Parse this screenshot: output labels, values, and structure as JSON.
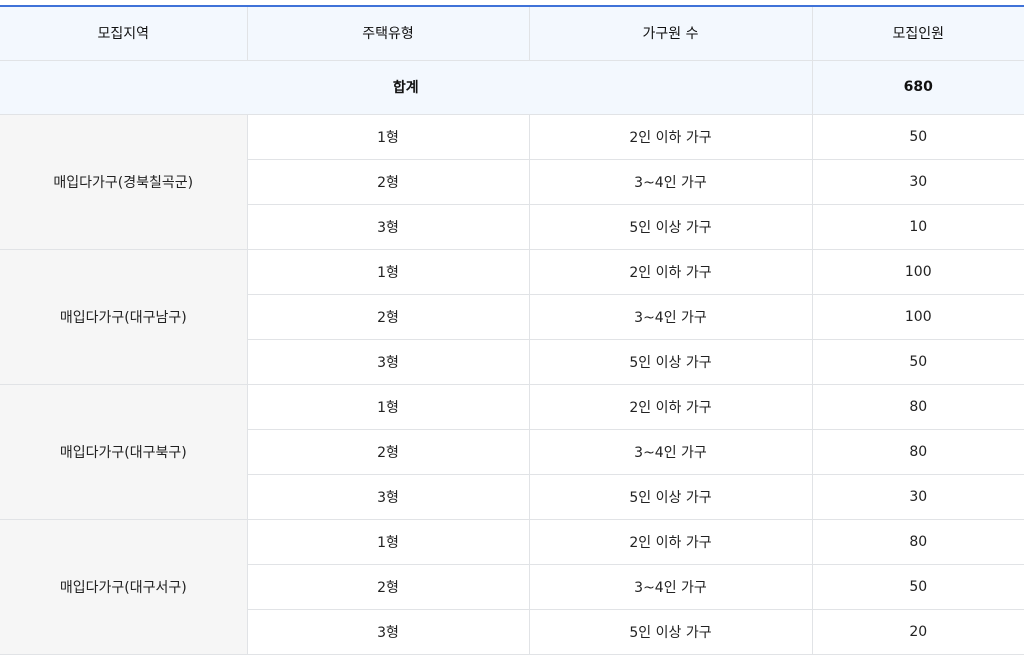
{
  "header": {
    "col_region": "모집지역",
    "col_type": "주택유형",
    "col_household": "가구원 수",
    "col_count": "모집인원"
  },
  "total": {
    "label": "합계",
    "value": "680"
  },
  "groups": [
    {
      "region": "매입다가구(경북칠곡군)",
      "rows": [
        {
          "type": "1형",
          "household": "2인 이하 가구",
          "count": "50"
        },
        {
          "type": "2형",
          "household": "3~4인 가구",
          "count": "30"
        },
        {
          "type": "3형",
          "household": "5인 이상 가구",
          "count": "10"
        }
      ]
    },
    {
      "region": "매입다가구(대구남구)",
      "rows": [
        {
          "type": "1형",
          "household": "2인 이하 가구",
          "count": "100"
        },
        {
          "type": "2형",
          "household": "3~4인 가구",
          "count": "100"
        },
        {
          "type": "3형",
          "household": "5인 이상 가구",
          "count": "50"
        }
      ]
    },
    {
      "region": "매입다가구(대구북구)",
      "rows": [
        {
          "type": "1형",
          "household": "2인 이하 가구",
          "count": "80"
        },
        {
          "type": "2형",
          "household": "3~4인 가구",
          "count": "80"
        },
        {
          "type": "3형",
          "household": "5인 이상 가구",
          "count": "30"
        }
      ]
    },
    {
      "region": "매입다가구(대구서구)",
      "rows": [
        {
          "type": "1형",
          "household": "2인 이하 가구",
          "count": "80"
        },
        {
          "type": "2형",
          "household": "3~4인 가구",
          "count": "50"
        },
        {
          "type": "3형",
          "household": "5인 이상 가구",
          "count": "20"
        }
      ]
    }
  ],
  "colors": {
    "accent": "#3f72d8",
    "header_bg": "#f3f8fe",
    "region_bg": "#f6f6f6",
    "border": "#e1e3e6"
  }
}
